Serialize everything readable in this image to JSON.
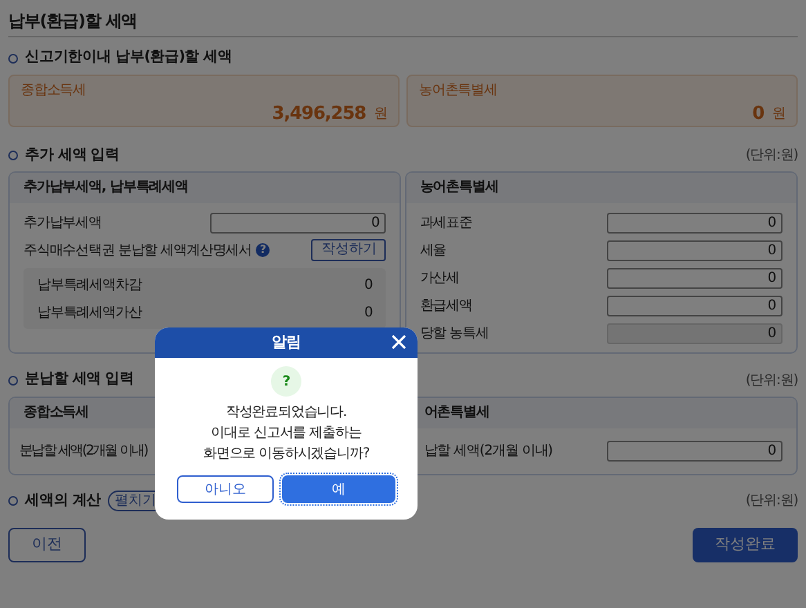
{
  "page_title": "납부(환급)할 세액",
  "section_due": {
    "title": "신고기한이내 납부(환급)할 세액",
    "cards": [
      {
        "label": "종합소득세",
        "amount": "3,496,258",
        "unit": "원"
      },
      {
        "label": "농어촌특별세",
        "amount": "0",
        "unit": "원"
      }
    ]
  },
  "section_additional": {
    "title": "추가 세액 입력",
    "unit_note": "(단위:원)",
    "left_panel": {
      "title": "추가납부세액, 납부특례세액",
      "rows": [
        {
          "label": "추가납부세액",
          "value": "0"
        }
      ],
      "statement": {
        "label": "주식매수선택권 분납할 세액계산명세서",
        "info": "?",
        "button": "작성하기"
      },
      "sub_rows": [
        {
          "label": "납부특례세액차감",
          "value": "0"
        },
        {
          "label": "납부특례세액가산",
          "value": "0"
        }
      ]
    },
    "right_panel": {
      "title": "농어촌특별세",
      "rows": [
        {
          "label": "과세표준",
          "value": "0",
          "disabled": false
        },
        {
          "label": "세율",
          "value": "0",
          "disabled": false
        },
        {
          "label": "가산세",
          "value": "0",
          "disabled": false
        },
        {
          "label": "환급세액",
          "value": "0",
          "disabled": false
        },
        {
          "label": "당할 농특세",
          "value": "0",
          "disabled": true
        }
      ]
    }
  },
  "section_installment": {
    "title": "분납할 세액 입력",
    "unit_note": "(단위:원)",
    "left_panel": {
      "title": "종합소득세",
      "rows": [
        {
          "label": "분납할 세액(2개월 이내)"
        }
      ]
    },
    "right_panel": {
      "title": "어촌특별세",
      "rows": [
        {
          "label": "납할 세액(2개월 이내)",
          "value": "0"
        }
      ]
    }
  },
  "section_calc": {
    "title": "세액의 계산",
    "toggle": "펼치기",
    "unit_note": "(단위:원)"
  },
  "footer": {
    "prev": "이전",
    "done": "작성완료"
  },
  "dialog": {
    "title": "알림",
    "icon": "?",
    "message": [
      "작성완료되었습니다.",
      "이대로 신고서를 제출하는",
      "화면으로 이동하시겠습니까?"
    ],
    "buttons": [
      {
        "label": "아니오",
        "kind": "secondary",
        "focused": false
      },
      {
        "label": "예",
        "kind": "primary",
        "focused": true
      }
    ]
  }
}
